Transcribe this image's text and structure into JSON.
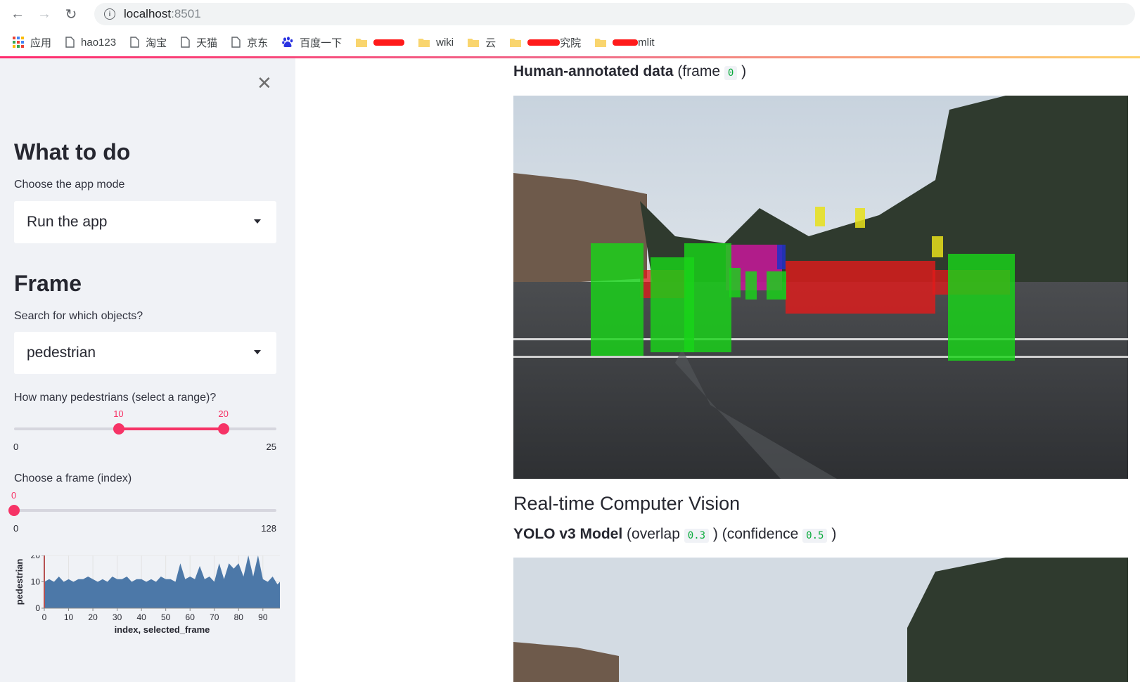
{
  "browser": {
    "address_host": "localhost",
    "address_port": ":8501",
    "bookmarks": [
      "应用",
      "hao123",
      "淘宝",
      "天猫",
      "京东",
      "百度一下",
      "wiki",
      "云",
      "究院",
      "mlit"
    ]
  },
  "sidebar": {
    "heading1": "What to do",
    "mode_label": "Choose the app mode",
    "mode_value": "Run the app",
    "heading2": "Frame",
    "objects_label": "Search for which objects?",
    "objects_value": "pedestrian",
    "range_label": "How many pedestrians (select a range)?",
    "range": {
      "low": 10,
      "high": 20,
      "min": 0,
      "max": 25,
      "low_label": "10",
      "high_label": "20",
      "min_label": "0",
      "max_label": "25"
    },
    "frame_label": "Choose a frame (index)",
    "frame": {
      "value": 0,
      "min": 0,
      "max": 128,
      "value_label": "0",
      "min_label": "0",
      "max_label": "128"
    }
  },
  "main": {
    "annotated_title": "Human-annotated data",
    "annotated_frame_prefix": "(frame",
    "annotated_frame_value": "0",
    "annotated_frame_suffix": ")",
    "cv_heading": "Real-time Computer Vision",
    "yolo_title": "YOLO v3 Model",
    "overlap_prefix": "(overlap",
    "overlap_value": "0.3",
    "overlap_suffix": ")",
    "confidence_prefix": "(confidence",
    "confidence_value": "0.5",
    "confidence_suffix": ")"
  },
  "colors": {
    "accent": "#f63366",
    "area": "#4c78a8",
    "code_green": "#09ab3b"
  },
  "chart_data": {
    "type": "area",
    "xlabel": "index, selected_frame",
    "ylabel": "pedestrian",
    "x_ticks": [
      0,
      10,
      20,
      30,
      40,
      50,
      60,
      70,
      80,
      90
    ],
    "y_ticks": [
      0,
      10,
      20
    ],
    "xlim": [
      0,
      97
    ],
    "ylim": [
      0,
      20
    ],
    "grid": true,
    "selected_frame": 0,
    "x": [
      0,
      2,
      4,
      6,
      8,
      10,
      12,
      14,
      16,
      18,
      20,
      22,
      24,
      26,
      28,
      30,
      32,
      34,
      36,
      38,
      40,
      42,
      44,
      46,
      48,
      50,
      52,
      54,
      56,
      58,
      60,
      62,
      64,
      66,
      68,
      70,
      72,
      74,
      76,
      78,
      80,
      82,
      84,
      86,
      88,
      90,
      92,
      94,
      96,
      97
    ],
    "values": [
      10,
      11,
      10,
      12,
      10,
      11,
      10,
      11,
      11,
      12,
      11,
      10,
      11,
      10,
      12,
      11,
      11,
      12,
      10,
      11,
      11,
      10,
      11,
      10,
      12,
      11,
      11,
      10,
      17,
      11,
      12,
      11,
      16,
      11,
      12,
      10,
      17,
      11,
      17,
      15,
      17,
      12,
      20,
      12,
      20,
      11,
      10,
      12,
      9,
      10
    ]
  }
}
